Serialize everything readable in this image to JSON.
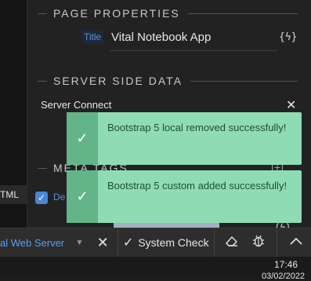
{
  "left_panel": {
    "tab_label": "TML"
  },
  "page_properties": {
    "header": "PAGE PROPERTIES",
    "title_label": "Title",
    "title_value": "Vital Notebook App",
    "bolt_button": "{ϟ}"
  },
  "server_side_data": {
    "header": "SERVER SIDE DATA",
    "server_connect_label": "Server Connect",
    "close_symbol": "✕"
  },
  "meta_tags": {
    "header": "META TAGS",
    "add_symbol": "[+]",
    "row_text": "De",
    "bolt_button": "{ϟ}"
  },
  "toasts": [
    {
      "message": "Bootstrap 5 local removed successfully!",
      "icon": "check-icon"
    },
    {
      "message": "Bootstrap 5 custom added successfully!",
      "icon": "check-icon"
    }
  ],
  "toolbar": {
    "server_select": "al Web Server",
    "close_symbol": "✕",
    "system_check_label": "System Check",
    "eraser_icon": "eraser-icon",
    "bug_icon": "bug-icon",
    "chevron_up_icon": "chevron-up-icon"
  },
  "taskbar": {
    "time": "17:46",
    "date": "03/02/2022"
  },
  "colors": {
    "toast_bg": "#8fdcb4",
    "toast_icon_bg": "#63b589",
    "accent_blue": "#5b8fd9"
  }
}
